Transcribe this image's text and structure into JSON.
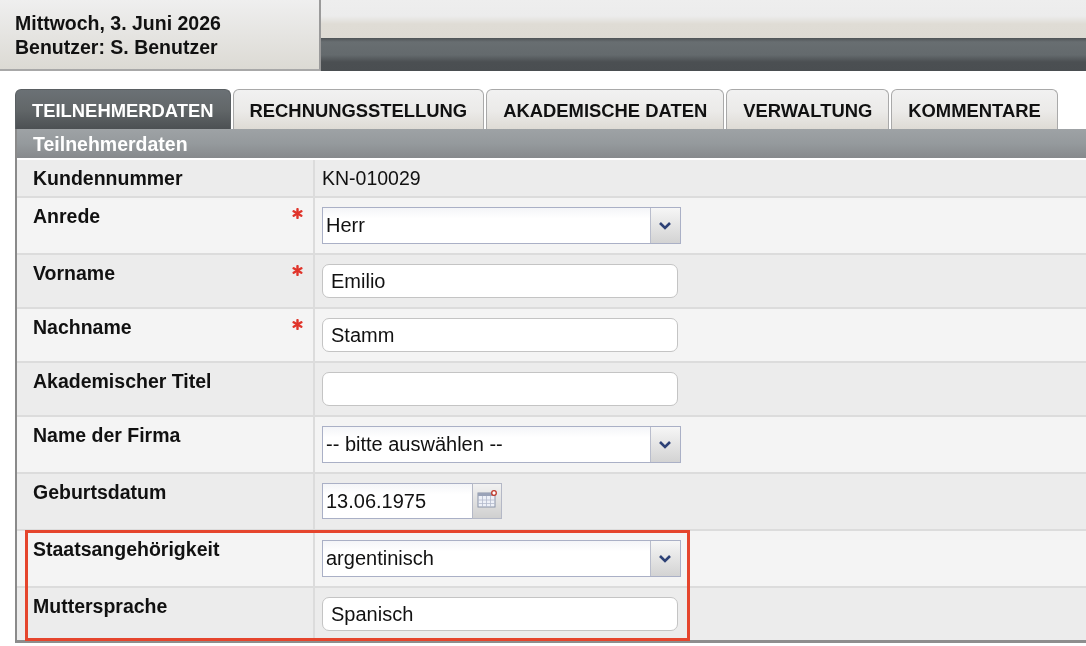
{
  "header": {
    "date": "Mittwoch, 3. Juni 2026",
    "user": "Benutzer: S. Benutzer"
  },
  "tabs": [
    {
      "label": "TEILNEHMERDATEN",
      "selected": true
    },
    {
      "label": "RECHNUNGSSTELLUNG",
      "selected": false
    },
    {
      "label": "AKADEMISCHE DATEN",
      "selected": false
    },
    {
      "label": "VERWALTUNG",
      "selected": false
    },
    {
      "label": "KOMMENTARE",
      "selected": false
    }
  ],
  "section": {
    "title": "Teilnehmerdaten"
  },
  "fields": [
    {
      "label": "Kundennummer",
      "kind": "text",
      "value": "KN-010029",
      "required": false,
      "highlighted": false
    },
    {
      "label": "Anrede",
      "kind": "select",
      "value": "Herr",
      "required": true,
      "highlighted": false
    },
    {
      "label": "Vorname",
      "kind": "input",
      "value": "Emilio",
      "required": true,
      "highlighted": false
    },
    {
      "label": "Nachname",
      "kind": "input",
      "value": "Stamm",
      "required": true,
      "highlighted": false
    },
    {
      "label": "Akademischer Titel",
      "kind": "input",
      "required": false,
      "highlighted": false
    },
    {
      "label": "Name der Firma",
      "kind": "select",
      "value": "-- bitte auswählen --",
      "required": false,
      "highlighted": false
    },
    {
      "label": "Geburtsdatum",
      "kind": "date",
      "value": "13.06.1975",
      "required": false,
      "highlighted": false
    },
    {
      "label": "Staatsangehörigkeit",
      "kind": "select",
      "value": "argentinisch",
      "required": false,
      "highlighted": true
    },
    {
      "label": "Muttersprache",
      "kind": "input",
      "value": "Spanisch",
      "required": false,
      "highlighted": true
    }
  ]
}
